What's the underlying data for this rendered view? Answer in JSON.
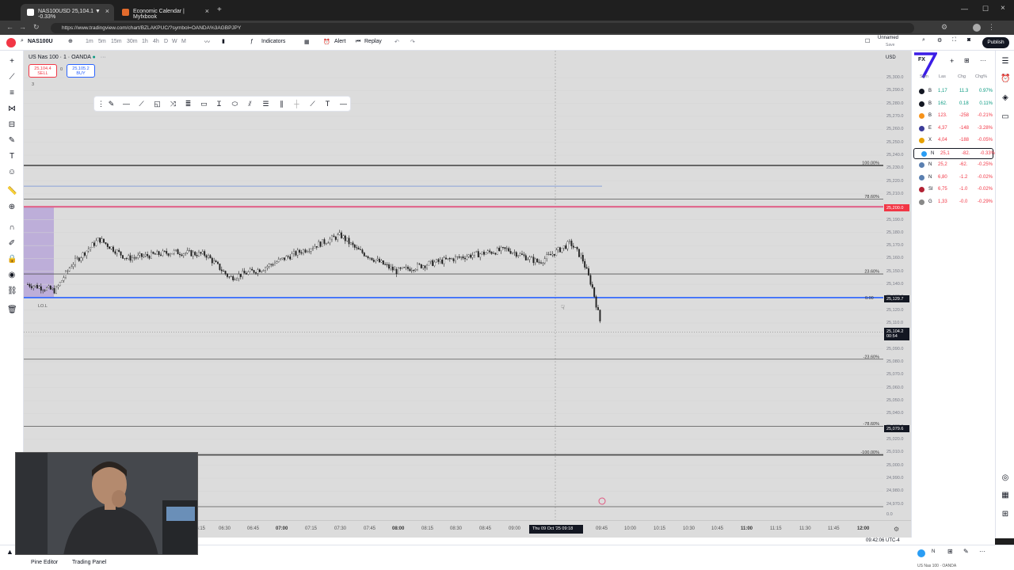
{
  "browser": {
    "tabs": [
      {
        "label": "NAS100USD 25,104.1 ▼ -0.33%",
        "active": true
      },
      {
        "label": "Economic Calendar | Myfxbook",
        "active": false
      }
    ],
    "new_tab": "+",
    "url": "https://www.tradingview.com/chart/BZLAKPUC/?symbol=OANDA%3AGBPJPY"
  },
  "toolbar": {
    "symbol": "NAS100U",
    "intervals": [
      "1m",
      "5m",
      "15m",
      "30m",
      "1h",
      "4h",
      "D",
      "W",
      "M"
    ],
    "indicators": "Indicators",
    "alert": "Alert",
    "replay": "Replay",
    "layout_name": "Unnamed",
    "layout_sub": "Save",
    "publish": "Publish"
  },
  "legend": {
    "title": "US Nas 100 · 1 · OANDA",
    "sell_price": "25,104.4",
    "sell_label": "SELL",
    "spread": "0",
    "buy_price": "25,105.2",
    "buy_label": "BUY",
    "count": "3"
  },
  "chart": {
    "currency": "USD",
    "price_labels": [
      "25,300.0",
      "25,290.0",
      "25,280.0",
      "25,270.0",
      "25,260.0",
      "25,250.0",
      "25,240.0",
      "25,230.0",
      "25,220.0",
      "25,210.0",
      "25,200.0",
      "25,190.0",
      "25,180.0",
      "25,170.0",
      "25,160.0",
      "25,150.0",
      "25,140.0",
      "25,130.0",
      "25,120.0",
      "25,110.0",
      "25,100.0",
      "25,090.0",
      "25,080.0",
      "25,070.0",
      "25,060.0",
      "25,050.0",
      "25,040.0",
      "25,030.0",
      "25,020.0",
      "25,010.0",
      "25,000.0",
      "24,990.0",
      "24,980.0",
      "24,970.0"
    ],
    "price_tags": {
      "red": "25,200.0",
      "blue": "25,129.7",
      "current": "25,104.2",
      "current_sub": "00:54",
      "bottom": "25,079.6"
    },
    "fib_labels": [
      "100.00%",
      "78.60%",
      "23.60%",
      "0.00",
      "-23.60%",
      "-78.60%",
      "-100.00%"
    ],
    "lol_label": "LO.L",
    "time_labels": [
      "06:15",
      "06:30",
      "06:45",
      "07:00",
      "07:15",
      "07:30",
      "07:45",
      "08:00",
      "08:15",
      "08:30",
      "08:45",
      "09:00",
      "09:45",
      "10:00",
      "10:15",
      "10:30",
      "10:45",
      "11:00",
      "11:15",
      "11:30",
      "11:45",
      "12:00"
    ],
    "crosshair_time": "Thu 09 Oct '25  09:18",
    "clock": "09:42:06 UTC-4",
    "zero_axis": "0.0"
  },
  "watchlist": {
    "header": "FX",
    "columns": [
      "Sym",
      "Las",
      "Chg",
      "Chg%"
    ],
    "rows": [
      {
        "sym": "B",
        "last": "1,17",
        "chg": "11.3",
        "pct": "0.97%",
        "color": "#131722",
        "up": true
      },
      {
        "sym": "B",
        "last": "162.",
        "chg": "0.18",
        "pct": "0.11%",
        "color": "#131722",
        "up": true
      },
      {
        "sym": "B",
        "last": "123.",
        "chg": "-258",
        "pct": "-0.21%",
        "color": "#f7931a",
        "up": false
      },
      {
        "sym": "E",
        "last": "4,37",
        "chg": "-148",
        "pct": "-3.28%",
        "color": "#3c3c98",
        "up": false
      },
      {
        "sym": "X",
        "last": "4,04",
        "chg": "-188",
        "pct": "-0.05%",
        "color": "#e6a100",
        "up": false
      },
      {
        "sym": "N",
        "last": "25,1",
        "chg": "-82.",
        "pct": "-0.33%",
        "color": "#2a9df4",
        "up": false
      },
      {
        "sym": "N",
        "last": "25,2",
        "chg": "-62.",
        "pct": "-0.25%",
        "color": "#5a7fb0",
        "up": false
      },
      {
        "sym": "N",
        "last": "6,80",
        "chg": "-1.2",
        "pct": "-0.02%",
        "color": "#5a7fb0",
        "up": false
      },
      {
        "sym": "SI",
        "last": "6,75",
        "chg": "-1.0",
        "pct": "-0.02%",
        "color": "#b22234",
        "up": false
      },
      {
        "sym": "G",
        "last": "1,33",
        "chg": "-0.0",
        "pct": "-0.29%",
        "color": "#888888",
        "up": false
      }
    ]
  },
  "bottom": {
    "pine_editor": "Pine Editor",
    "trading_panel": "Trading Panel",
    "ticker": "US Nas 100 · OANDA"
  },
  "colors": {
    "accent": "#2962ff",
    "down": "#f23645",
    "up": "#089981",
    "pink_line": "#e0638a",
    "zone": "#b7a6d8"
  }
}
